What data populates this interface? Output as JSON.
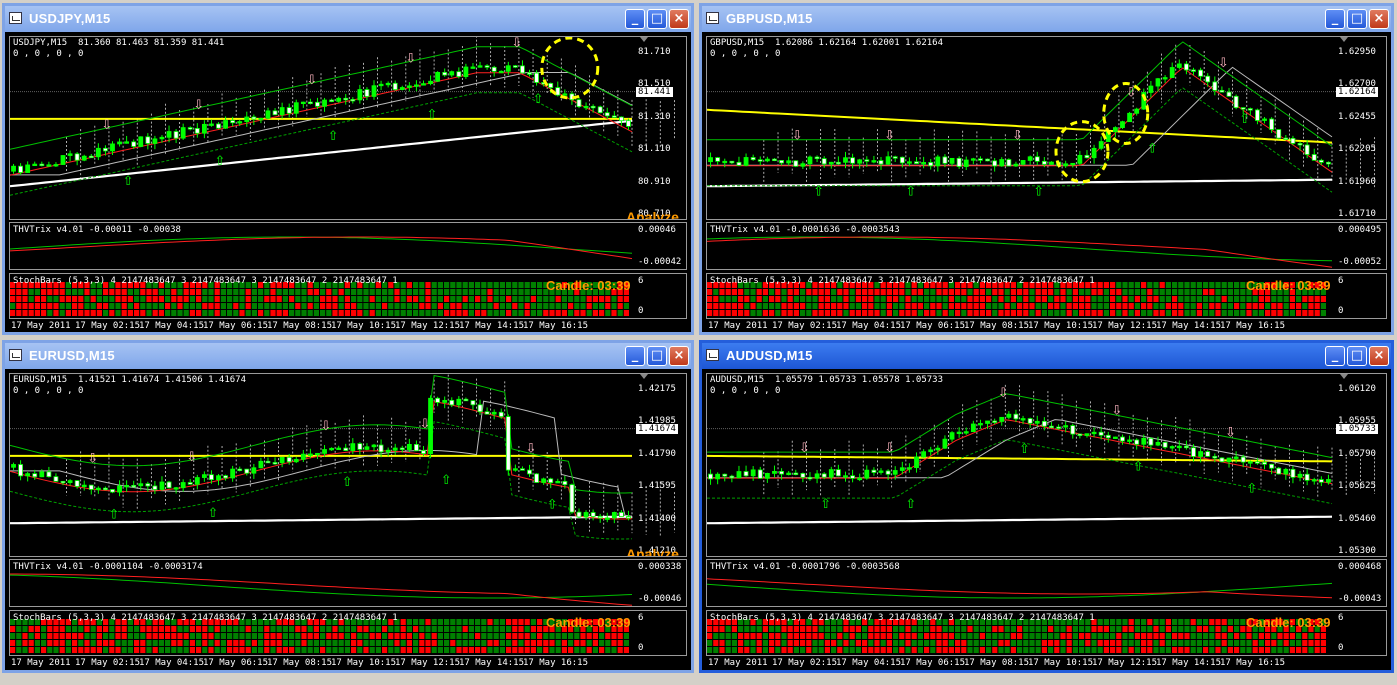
{
  "windows": [
    {
      "title": "USDJPY,M15",
      "active": false,
      "header": "USDJPY,M15  81.360 81.463 81.359 81.441",
      "subheader": "0 , 0 , 0 , 0",
      "price_axis": [
        "81.710",
        "81.510",
        "81.310",
        "81.110",
        "80.910",
        "80.710"
      ],
      "current_price": "81.441",
      "indicator_label": "THVTrix v4.01 -0.00011 -0.00038",
      "indicator_axis": [
        "0.00046",
        "-0.00042"
      ],
      "stoch_label": "StochBars (5,3,3) 4 2147483647 3 2147483647 3 2147483647 2 2147483647 1",
      "stoch_axis": [
        "6",
        "0"
      ],
      "candle_text": "Candle:  03:39",
      "overlay_text": "Analyze Exit",
      "time_labels": [
        "17 May 2011",
        "17 May 02:15",
        "17 May 04:15",
        "17 May 06:15",
        "17 May 08:15",
        "17 May 10:15",
        "17 May 12:15",
        "17 May 14:15",
        "17 May 16:15"
      ]
    },
    {
      "title": "GBPUSD,M15",
      "active": false,
      "header": "GBPUSD,M15  1.62086 1.62164 1.62001 1.62164",
      "subheader": "0 , 0 , 0 , 0",
      "price_axis": [
        "1.62950",
        "1.62700",
        "1.62455",
        "1.62205",
        "1.61960",
        "1.61710"
      ],
      "current_price": "1.62164",
      "indicator_label": "THVTrix v4.01 -0.0001636 -0.0003543",
      "indicator_axis": [
        "0.000495",
        "-0.00052"
      ],
      "stoch_label": "StochBars (5,3,3) 4 2147483647 3 2147483647 3 2147483647 2 2147483647 1",
      "stoch_axis": [
        "6",
        "0"
      ],
      "candle_text": "Candle:  03:39",
      "overlay_text": "",
      "time_labels": [
        "17 May 2011",
        "17 May 02:15",
        "17 May 04:15",
        "17 May 06:15",
        "17 May 08:15",
        "17 May 10:15",
        "17 May 12:15",
        "17 May 14:15",
        "17 May 16:15"
      ]
    },
    {
      "title": "EURUSD,M15",
      "active": false,
      "header": "EURUSD,M15  1.41521 1.41674 1.41506 1.41674",
      "subheader": "0 , 0 , 0 , 0",
      "price_axis": [
        "1.42175",
        "1.41985",
        "1.41790",
        "1.41595",
        "1.41400",
        "1.41210"
      ],
      "current_price": "1.41674",
      "indicator_label": "THVTrix v4.01 -0.0001104 -0.0003174",
      "indicator_axis": [
        "0.000338",
        "-0.00046"
      ],
      "stoch_label": "StochBars (5,3,3) 4 2147483647 3 2147483647 3 2147483647 2 2147483647 1",
      "stoch_axis": [
        "6",
        "0"
      ],
      "candle_text": "Candle:  03:39",
      "overlay_text": "Analyze Exit",
      "time_labels": [
        "17 May 2011",
        "17 May 02:15",
        "17 May 04:15",
        "17 May 06:15",
        "17 May 08:15",
        "17 May 10:15",
        "17 May 12:15",
        "17 May 14:15",
        "17 May 16:15"
      ]
    },
    {
      "title": "AUDUSD,M15",
      "active": true,
      "header": "AUDUSD,M15  1.05579 1.05733 1.05578 1.05733",
      "subheader": "0 , 0 , 0 , 0",
      "price_axis": [
        "1.06120",
        "1.05955",
        "1.05790",
        "1.05625",
        "1.05460",
        "1.05300"
      ],
      "current_price": "1.05733",
      "indicator_label": "THVTrix v4.01 -0.0001796 -0.0003568",
      "indicator_axis": [
        "0.000468",
        "-0.00043"
      ],
      "stoch_label": "StochBars (5,3,3) 4 2147483647 3 2147483647 3 2147483647 2 2147483647 1",
      "stoch_axis": [
        "6",
        "0"
      ],
      "candle_text": "Candle:  03:39",
      "overlay_text": "",
      "time_labels": [
        "17 May 2011",
        "17 May 02:15",
        "17 May 04:15",
        "17 May 06:15",
        "17 May 08:15",
        "17 May 10:15",
        "17 May 12:15",
        "17 May 14:15",
        "17 May 16:15"
      ]
    }
  ],
  "window_buttons": {
    "minimize": "_",
    "maximize": "□",
    "close": "×"
  },
  "colors": {
    "bull": "#00ff00",
    "bear": "#ffffff",
    "ma_yellow": "#ffff00",
    "trix_green": "#00c000",
    "trix_red": "#ff2020",
    "candle_text": "#ff9a00",
    "active_title": "#245edb",
    "inactive_title": "#7ea3e6"
  }
}
